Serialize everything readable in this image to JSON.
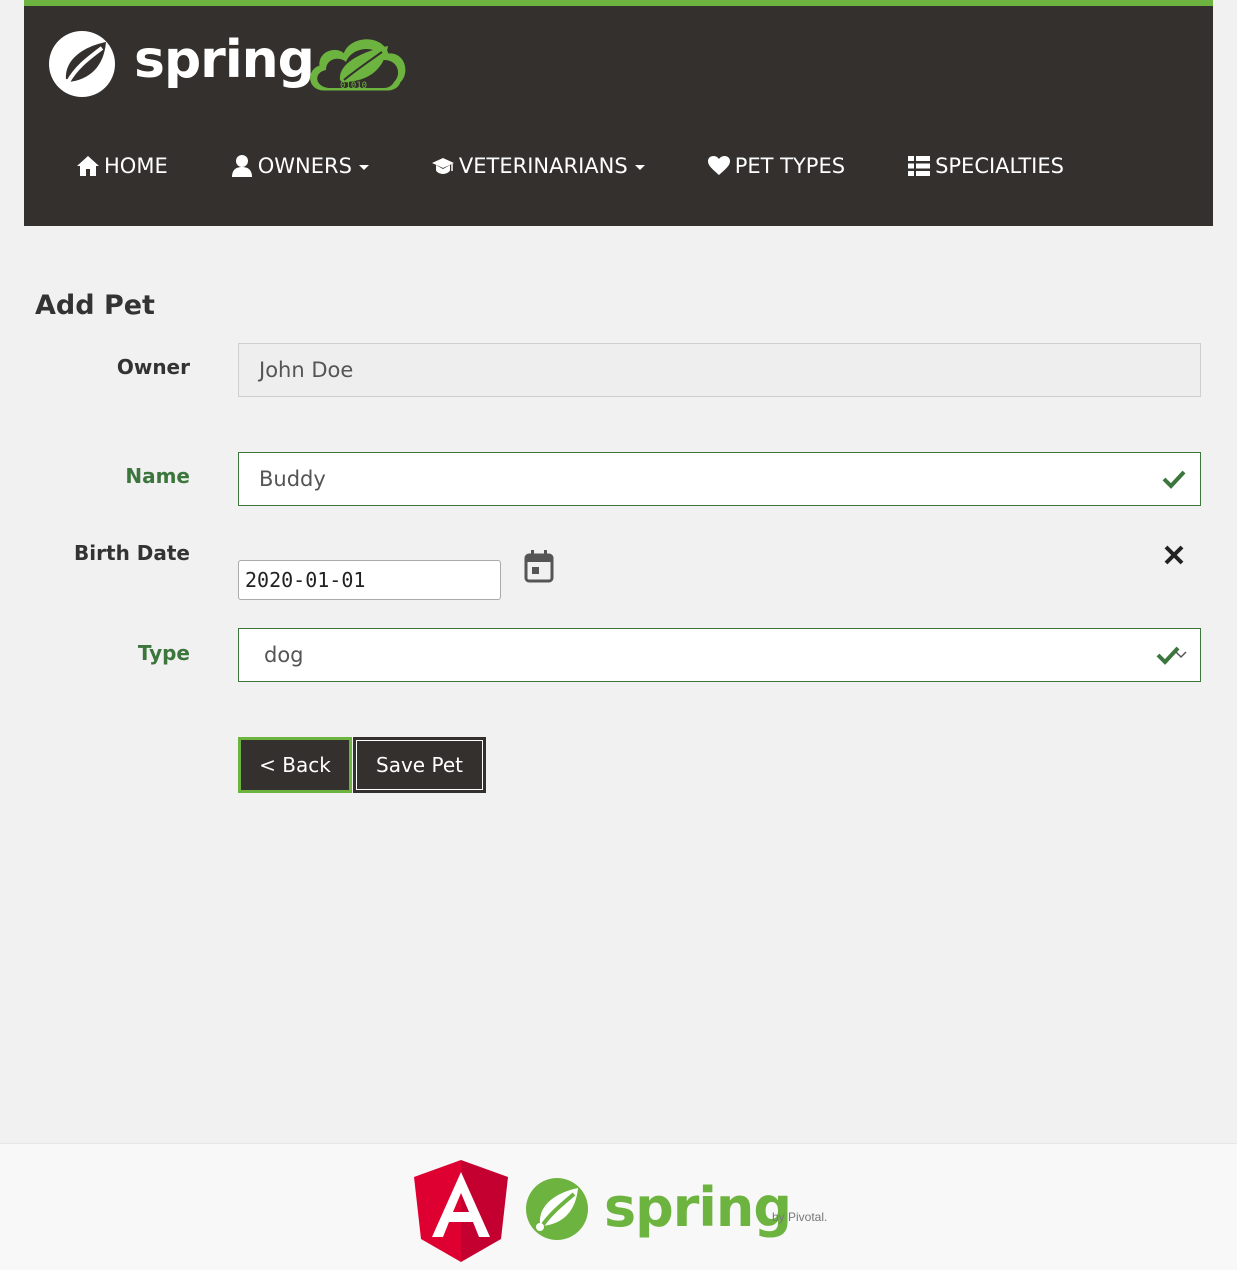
{
  "brand": {
    "logo_text": "spring",
    "badge_text": "01010"
  },
  "nav": {
    "items": [
      {
        "label": "HOME",
        "icon": "home-icon",
        "dropdown": false
      },
      {
        "label": "OWNERS",
        "icon": "user-icon",
        "dropdown": true
      },
      {
        "label": "VETERINARIANS",
        "icon": "graduation-cap-icon",
        "dropdown": true
      },
      {
        "label": "PET TYPES",
        "icon": "heart-icon",
        "dropdown": false
      },
      {
        "label": "SPECIALTIES",
        "icon": "list-icon",
        "dropdown": false
      }
    ]
  },
  "form": {
    "title": "Add Pet",
    "owner": {
      "label": "Owner",
      "value": "John Doe"
    },
    "name": {
      "label": "Name",
      "value": "Buddy"
    },
    "birth_date": {
      "label": "Birth Date",
      "value": "2020-01-01"
    },
    "type": {
      "label": "Type",
      "value": "dog"
    },
    "back_label": "< Back",
    "save_label": "Save Pet"
  },
  "footer": {
    "spring_text": "spring",
    "by_text": "by Pivotal."
  },
  "colors": {
    "nav_bg": "#34302d",
    "accent_green": "#6db33f",
    "valid_green": "#3c763d",
    "angular_red": "#dd0031"
  }
}
